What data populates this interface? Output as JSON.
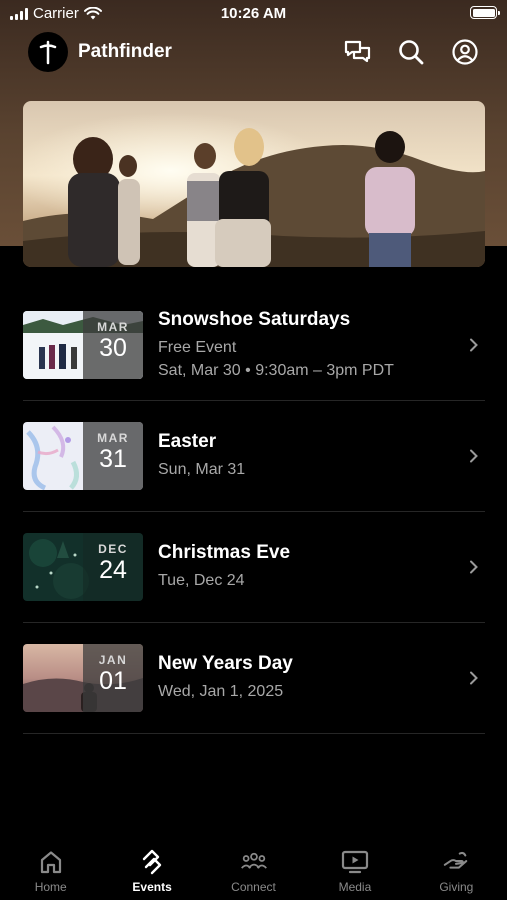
{
  "status_bar": {
    "carrier": "Carrier",
    "time": "10:26 AM"
  },
  "app": {
    "title": "Pathfinder"
  },
  "events": [
    {
      "month": "MAR",
      "day": "30",
      "title": "Snowshoe Saturdays",
      "lines": [
        "Free Event",
        "Sat, Mar 30 • 9:30am – 3pm PDT"
      ]
    },
    {
      "month": "MAR",
      "day": "31",
      "title": "Easter",
      "lines": [
        "Sun, Mar 31"
      ]
    },
    {
      "month": "DEC",
      "day": "24",
      "title": "Christmas Eve",
      "lines": [
        "Tue, Dec 24"
      ]
    },
    {
      "month": "JAN",
      "day": "01",
      "title": "New Years Day",
      "lines": [
        "Wed, Jan 1, 2025"
      ]
    }
  ],
  "tabs": [
    {
      "label": "Home",
      "icon": "home-icon"
    },
    {
      "label": "Events",
      "icon": "events-icon",
      "active": true
    },
    {
      "label": "Connect",
      "icon": "connect-icon"
    },
    {
      "label": "Media",
      "icon": "media-icon"
    },
    {
      "label": "Giving",
      "icon": "giving-icon"
    }
  ],
  "colors": {
    "background": "#000000",
    "header_brown": "#5a4330",
    "muted_text": "#a8a8a8",
    "tab_inactive": "#8a8a8a"
  }
}
